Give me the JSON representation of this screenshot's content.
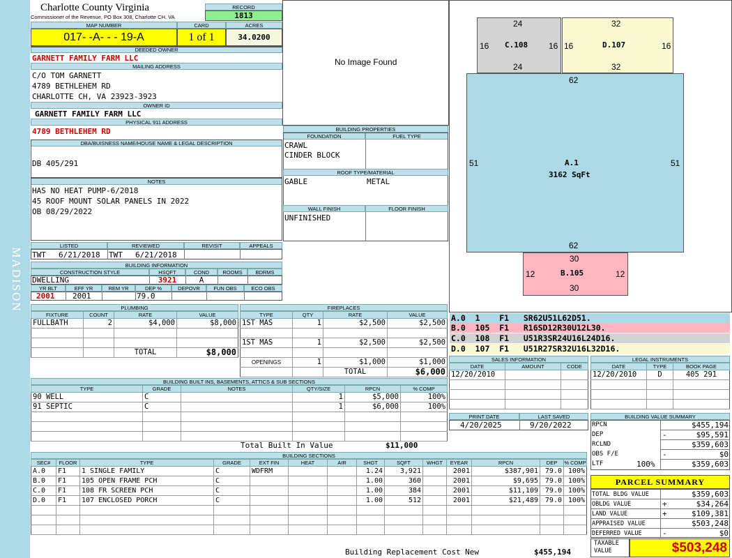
{
  "sidebar": {
    "district": "MADISON"
  },
  "header": {
    "county": "Charlotte County Virginia",
    "commissioner": "Commissioner of the Revenue, PO Box 308, Charlotte CH, VA",
    "record_label": "RECORD",
    "record": "1813",
    "map_label": "MAP NUMBER",
    "map_number": "017- -A- - - 19-A",
    "card_label": "CARD",
    "card": "1 of 1",
    "acres_label": "ACRES",
    "acres": "34.0200"
  },
  "owner": {
    "deeded_label": "DEEDED OWNER",
    "deeded": "GARNETT FAMILY FARM LLC",
    "mailing_label": "MAILING ADDRESS",
    "mailing": [
      "C/O TOM GARNETT",
      "4789 BETHLEHEM RD",
      "CHARLOTTE CH, VA 23923-3923"
    ],
    "owner_id_label": "OWNER ID",
    "owner_id": "GARNETT FAMILY FARM LLC",
    "physical_label": "PHYSICAL 911 ADDRESS",
    "physical": "4789 BETHLEHEM RD"
  },
  "legal": {
    "label": "DBA/BUISNESS NAME/HOUSE NAME & LEGAL DESCRIPTION",
    "text": "DB 405/291"
  },
  "notes": {
    "label": "NOTES",
    "lines": [
      "HAS NO HEAT PUMP-6/2018",
      "45 ROOF MOUNT SOLAR PANELS IN 2022",
      "OB 08/29/2022"
    ]
  },
  "image": {
    "text": "No Image Found"
  },
  "listing": {
    "listed_label": "LISTED",
    "listed_by": "TWT",
    "listed_date": "6/21/2018",
    "reviewed_label": "REVIEWED",
    "reviewed_by": "TWT",
    "reviewed_date": "6/21/2018",
    "revisit_label": "REVISIT",
    "appeals_label": "APPEALS"
  },
  "building_info": {
    "label": "BUILDING INFORMATION",
    "construction_label": "CONSTRUCTION STYLE",
    "hsqft_label": "HSQFT",
    "cond_label": "COND",
    "rooms_label": "ROOMS",
    "bdrms_label": "BDRMS",
    "construction": "DWELLING",
    "hsqft": "3921",
    "cond": "A",
    "yr_blt_label": "YR BLT",
    "eff_yr_label": "EFF YR",
    "rem_yr_label": "REM YR",
    "dep_label": "DEP %",
    "depovr_label": "DEPOVR",
    "fun_obs_label": "FUN OBS",
    "eco_obs_label": "ECO OBS",
    "yr_blt": "2001",
    "eff_yr": "2001",
    "dep": "79.0"
  },
  "building_props": {
    "label": "BUILDING PROPERTIES",
    "foundation_label": "FOUNDATION",
    "fuel_label": "FUEL TYPE",
    "foundation": [
      "CRAWL",
      "CINDER BLOCK"
    ],
    "roof_label": "ROOF TYPE/MATERIAL",
    "roof_type": "GABLE",
    "roof_material": "METAL",
    "wall_label": "WALL FINISH",
    "floor_label": "FLOOR FINISH",
    "wall": "UNFINISHED"
  },
  "plumbing": {
    "label": "PLUMBING",
    "headers": [
      "FIXTURE",
      "COUNT",
      "RATE",
      "VALUE"
    ],
    "rows": [
      [
        "FULLBATH",
        "2",
        "$4,000",
        "$8,000"
      ]
    ],
    "total_label": "TOTAL",
    "total": "$8,000"
  },
  "fireplaces": {
    "label": "FIREPLACES",
    "headers": [
      "TYPE",
      "QTY",
      "RATE",
      "VALUE"
    ],
    "rows": [
      [
        "1ST MAS",
        "1",
        "$2,500",
        "$2,500"
      ],
      [
        "1ST MAS",
        "1",
        "$2,500",
        "$2,500"
      ]
    ],
    "openings_label": "OPENINGS",
    "openings": [
      "1",
      "$1,000",
      "$1,000"
    ],
    "total_label": "TOTAL",
    "total": "$6,000"
  },
  "built_ins": {
    "label": "BUILDING BUILT INS, BASEMENTS, ATTICS & SUB SECTIONS",
    "headers": [
      "TYPE",
      "GRADE",
      "NOTES",
      "QTY/SIZE",
      "RPCN",
      "% COMP"
    ],
    "rows": [
      [
        "90 WELL",
        "C",
        "",
        "1",
        "$5,000",
        "100%"
      ],
      [
        "91 SEPTIC",
        "C",
        "",
        "1",
        "$6,000",
        "100%"
      ]
    ],
    "total_label": "Total Built In Value",
    "total": "$11,000"
  },
  "sections": {
    "label": "BUILDING SECTIONS",
    "headers": [
      "SEC#",
      "FLOOR",
      "TYPE",
      "GRADE",
      "EXT FIN",
      "HEAT",
      "AIR",
      "SHGT",
      "SQFT",
      "WHGT",
      "EYEAR",
      "RPCN",
      "DEP",
      "% COMP"
    ],
    "rows": [
      [
        "A.0",
        "F1",
        "1 SINGLE FAMILY",
        "C",
        "WDFRM",
        "",
        "",
        "1.24",
        "3,921",
        "",
        "2001",
        "$387,901",
        "79.0",
        "100%"
      ],
      [
        "B.0",
        "F1",
        "105 OPEN FRAME PCH",
        "C",
        "",
        "",
        "",
        "1.00",
        "360",
        "",
        "2001",
        "$9,695",
        "79.0",
        "100%"
      ],
      [
        "C.0",
        "F1",
        "108 FR SCREEN PCH",
        "C",
        "",
        "",
        "",
        "1.00",
        "384",
        "",
        "2001",
        "$11,109",
        "79.0",
        "100%"
      ],
      [
        "D.0",
        "F1",
        "107 ENCLOSED PORCH",
        "C",
        "",
        "",
        "",
        "1.00",
        "512",
        "",
        "2001",
        "$21,489",
        "79.0",
        "100%"
      ]
    ],
    "rcn_label": "Building Replacement Cost New",
    "rcn": "$455,194"
  },
  "sketch": {
    "areas": [
      {
        "id": "C.108",
        "top": "24",
        "bottom": "24",
        "left": "16",
        "right": "16",
        "color": "#d3d3d3"
      },
      {
        "id": "D.107",
        "top": "32",
        "bottom": "32",
        "left": "16",
        "right": "16",
        "color": "#fafad2"
      },
      {
        "id": "A.1",
        "sub": "3162 SqFt",
        "top": "62",
        "bottom": "62",
        "left": "51",
        "right": "51",
        "color": "#add8e6"
      },
      {
        "id": "B.105",
        "top": "30",
        "bottom": "30",
        "left": "12",
        "right": "12",
        "color": "#ffb6c1"
      }
    ],
    "segments": [
      {
        "text": "A.0  1    F1   SR62U51L62D51.",
        "color": "#add8e6"
      },
      {
        "text": "B.0  105  F1   R16SD12R30U12L30.",
        "color": "#ffb6c1"
      },
      {
        "text": "C.0  108  F1   U51R3SR24U16L24D16.",
        "color": "#d3d3d3"
      },
      {
        "text": "D.0  107  F1   U51R27SR32U16L32D16.",
        "color": "#fafad2"
      }
    ]
  },
  "sales": {
    "label": "SALES INFORMATION",
    "headers": [
      "DATE",
      "AMOUNT",
      "CODE"
    ],
    "rows": [
      [
        "12/20/2010",
        "",
        ""
      ]
    ]
  },
  "instruments": {
    "label": "LEGAL INSTRUMENTS",
    "headers": [
      "DATE",
      "TYPE",
      "BOOK PAGE"
    ],
    "rows": [
      [
        "12/20/2010",
        "D",
        "405 291"
      ]
    ]
  },
  "print": {
    "print_label": "PRINT DATE",
    "print_date": "4/20/2025",
    "saved_label": "LAST SAVED",
    "saved_date": "9/20/2022"
  },
  "value_summary": {
    "label": "BUILDING VALUE SUMMARY",
    "rows": [
      {
        "name": "RPCN",
        "op": "",
        "value": "$455,194"
      },
      {
        "name": "DEP",
        "op": "-",
        "value": "$95,591"
      },
      {
        "name": "RCLND",
        "op": "",
        "value": "$359,603"
      },
      {
        "name": "OBS F/E",
        "op": "-",
        "value": "$0"
      },
      {
        "name": "LTF",
        "pct": "100%",
        "op": "",
        "value": "$359,603"
      }
    ]
  },
  "parcel": {
    "label": "PARCEL SUMMARY",
    "rows": [
      {
        "name": "TOTAL BLDG VALUE",
        "op": "",
        "value": "$359,603"
      },
      {
        "name": "OBLDG VALUE",
        "op": "+",
        "value": "$34,264"
      },
      {
        "name": "LAND VALUE",
        "op": "+",
        "value": "$109,381"
      },
      {
        "name": "APPRAISED VALUE",
        "op": "",
        "value": "$503,248"
      },
      {
        "name": "DEFERRED VALUE",
        "op": "-",
        "value": "$0"
      }
    ],
    "taxable_label": "TAXABLE VALUE",
    "taxable": "$503,248"
  }
}
